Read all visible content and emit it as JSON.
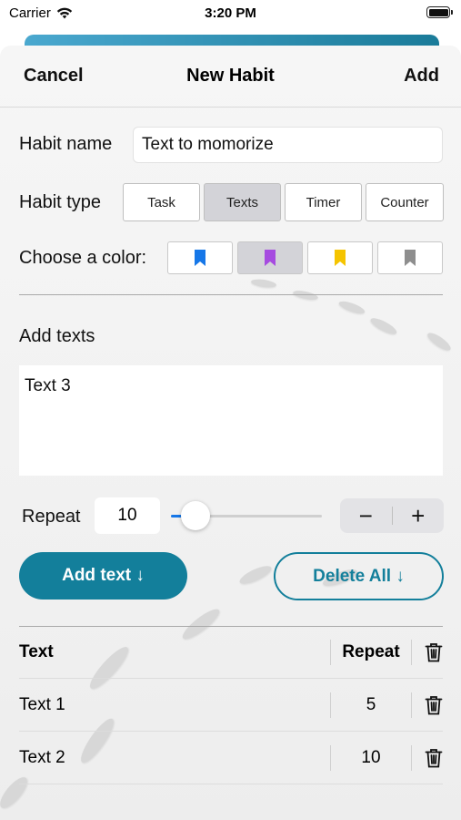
{
  "status_bar": {
    "carrier": "Carrier",
    "time": "3:20 PM",
    "icons": [
      "wifi-icon",
      "battery-icon"
    ]
  },
  "nav": {
    "cancel_label": "Cancel",
    "title": "New Habit",
    "add_label": "Add"
  },
  "form": {
    "habit_name_label": "Habit name",
    "habit_name_value": "Text to momorize",
    "habit_type_label": "Habit type",
    "habit_types": [
      "Task",
      "Texts",
      "Timer",
      "Counter"
    ],
    "habit_type_selected": "Texts",
    "color_label": "Choose a color:",
    "colors": [
      {
        "name": "blue",
        "hex": "#1677e8",
        "selected": false
      },
      {
        "name": "purple",
        "hex": "#a64be0",
        "selected": true
      },
      {
        "name": "yellow",
        "hex": "#f5c400",
        "selected": false
      },
      {
        "name": "gray",
        "hex": "#8e8e8e",
        "selected": false
      }
    ],
    "add_texts_label": "Add texts",
    "texts_value": "Text 3",
    "repeat_label": "Repeat",
    "repeat_value": "10",
    "slider_fraction": 0.08,
    "stepper_minus": "−",
    "stepper_plus": "+",
    "add_text_button": "Add text ↓",
    "delete_all_button": "Delete All ↓"
  },
  "table": {
    "header": {
      "text": "Text",
      "repeat": "Repeat"
    },
    "rows": [
      {
        "text": "Text 1",
        "repeat": "5"
      },
      {
        "text": "Text 2",
        "repeat": "10"
      }
    ]
  },
  "colors": {
    "accent": "#137f9b",
    "slider": "#1677e8",
    "segment_selected": "#d3d3d8"
  }
}
